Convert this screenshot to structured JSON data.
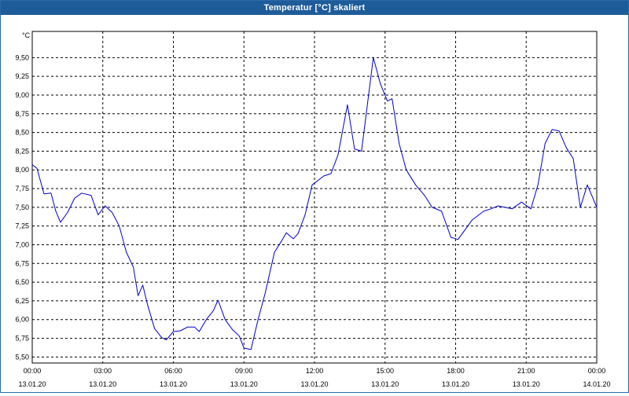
{
  "window": {
    "title": "Temperatur [°C] skaliert"
  },
  "chart_data": {
    "type": "line",
    "title": "Temperatur [°C] skaliert",
    "ylabel": "°C",
    "xlabel": "",
    "ylim": [
      5.42,
      9.85
    ],
    "xlim": [
      0,
      24
    ],
    "grid": true,
    "line_color": "#0000c8",
    "y_ticks": [
      "5,50",
      "5,75",
      "6,00",
      "6,25",
      "6,50",
      "6,75",
      "7,00",
      "7,25",
      "7,50",
      "7,75",
      "8,00",
      "8,25",
      "8,50",
      "8,75",
      "9,00",
      "9,25",
      "9,50"
    ],
    "x_ticks": [
      {
        "time": "00:00",
        "date": "13.01.20"
      },
      {
        "time": "03:00",
        "date": "13.01.20"
      },
      {
        "time": "06:00",
        "date": "13.01.20"
      },
      {
        "time": "09:00",
        "date": "13.01.20"
      },
      {
        "time": "12:00",
        "date": "13.01.20"
      },
      {
        "time": "15:00",
        "date": "13.01.20"
      },
      {
        "time": "18:00",
        "date": "13.01.20"
      },
      {
        "time": "21:00",
        "date": "13.01.20"
      },
      {
        "time": "00:00",
        "date": "14.01.20"
      }
    ],
    "series": [
      {
        "values": [
          [
            0.0,
            8.07
          ],
          [
            0.2,
            8.02
          ],
          [
            0.5,
            7.68
          ],
          [
            0.8,
            7.69
          ],
          [
            1.0,
            7.45
          ],
          [
            1.2,
            7.3
          ],
          [
            1.5,
            7.43
          ],
          [
            1.8,
            7.62
          ],
          [
            2.1,
            7.69
          ],
          [
            2.5,
            7.66
          ],
          [
            2.8,
            7.4
          ],
          [
            3.1,
            7.52
          ],
          [
            3.4,
            7.43
          ],
          [
            3.7,
            7.25
          ],
          [
            4.0,
            6.9
          ],
          [
            4.3,
            6.7
          ],
          [
            4.5,
            6.32
          ],
          [
            4.7,
            6.46
          ],
          [
            4.9,
            6.2
          ],
          [
            5.2,
            5.88
          ],
          [
            5.5,
            5.76
          ],
          [
            5.7,
            5.73
          ],
          [
            6.0,
            5.84
          ],
          [
            6.3,
            5.85
          ],
          [
            6.6,
            5.9
          ],
          [
            6.9,
            5.9
          ],
          [
            7.1,
            5.84
          ],
          [
            7.4,
            6.0
          ],
          [
            7.7,
            6.12
          ],
          [
            7.9,
            6.26
          ],
          [
            8.2,
            6.0
          ],
          [
            8.5,
            5.87
          ],
          [
            8.8,
            5.78
          ],
          [
            9.0,
            5.62
          ],
          [
            9.3,
            5.6
          ],
          [
            9.6,
            6.0
          ],
          [
            9.9,
            6.35
          ],
          [
            10.3,
            6.9
          ],
          [
            10.6,
            7.05
          ],
          [
            10.8,
            7.16
          ],
          [
            11.1,
            7.08
          ],
          [
            11.3,
            7.15
          ],
          [
            11.6,
            7.4
          ],
          [
            11.9,
            7.8
          ],
          [
            12.4,
            7.92
          ],
          [
            12.7,
            7.95
          ],
          [
            13.0,
            8.2
          ],
          [
            13.4,
            8.87
          ],
          [
            13.7,
            8.28
          ],
          [
            14.0,
            8.25
          ],
          [
            14.5,
            9.5
          ],
          [
            14.8,
            9.15
          ],
          [
            15.1,
            8.92
          ],
          [
            15.3,
            8.95
          ],
          [
            15.6,
            8.35
          ],
          [
            15.9,
            8.0
          ],
          [
            16.3,
            7.8
          ],
          [
            16.7,
            7.65
          ],
          [
            17.0,
            7.5
          ],
          [
            17.4,
            7.45
          ],
          [
            17.8,
            7.1
          ],
          [
            18.1,
            7.07
          ],
          [
            18.4,
            7.2
          ],
          [
            18.7,
            7.33
          ],
          [
            19.2,
            7.45
          ],
          [
            19.5,
            7.48
          ],
          [
            19.8,
            7.52
          ],
          [
            20.1,
            7.5
          ],
          [
            20.4,
            7.48
          ],
          [
            20.8,
            7.57
          ],
          [
            21.2,
            7.48
          ],
          [
            21.5,
            7.8
          ],
          [
            21.8,
            8.35
          ],
          [
            22.1,
            8.54
          ],
          [
            22.4,
            8.52
          ],
          [
            22.7,
            8.3
          ],
          [
            23.0,
            8.15
          ],
          [
            23.3,
            7.5
          ],
          [
            23.6,
            7.8
          ],
          [
            24.0,
            7.5
          ]
        ]
      }
    ]
  }
}
